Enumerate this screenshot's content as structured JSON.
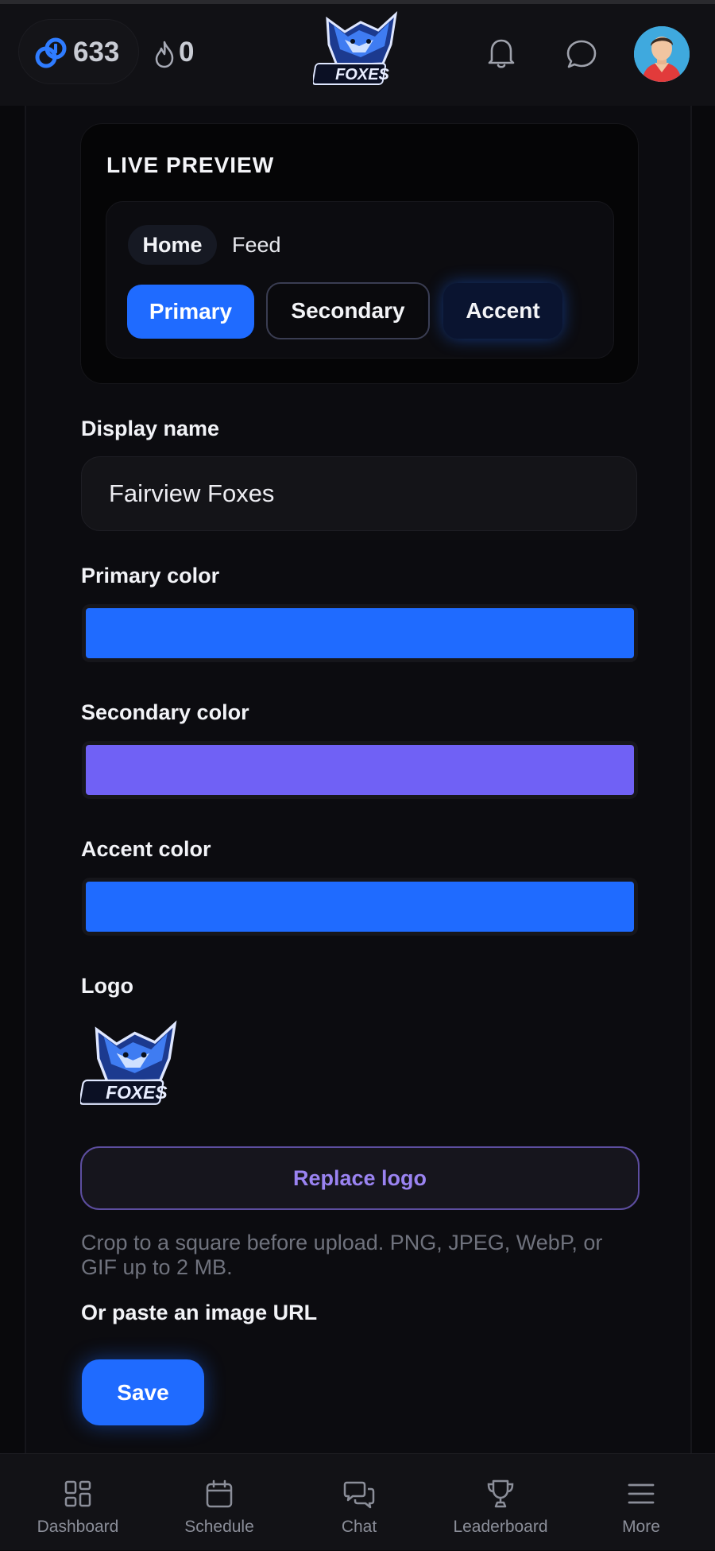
{
  "header": {
    "coins": "633",
    "streak": "0",
    "logo_text": "FOXES"
  },
  "preview": {
    "title": "LIVE PREVIEW",
    "tab_active": "Home",
    "tab_inactive": "Feed",
    "primary_label": "Primary",
    "secondary_label": "Secondary",
    "accent_label": "Accent"
  },
  "form": {
    "display_name_label": "Display name",
    "display_name_value": "Fairview Foxes",
    "primary_color_label": "Primary color",
    "primary_color": "#1f6bff",
    "secondary_color_label": "Secondary color",
    "secondary_color": "#7061f5",
    "accent_color_label": "Accent color",
    "accent_color": "#1f6bff",
    "logo_label": "Logo",
    "replace_logo_label": "Replace logo",
    "help_text": "Crop to a square before upload. PNG, JPEG, WebP, or GIF up to 2 MB.",
    "url_label": "Or paste an image URL",
    "save_label": "Save"
  },
  "nav": {
    "items": [
      {
        "label": "Dashboard",
        "icon": "dashboard-icon"
      },
      {
        "label": "Schedule",
        "icon": "calendar-icon"
      },
      {
        "label": "Chat",
        "icon": "chat-icon"
      },
      {
        "label": "Leaderboard",
        "icon": "trophy-icon"
      },
      {
        "label": "More",
        "icon": "menu-icon"
      }
    ]
  },
  "colors": {
    "brand_blue": "#1f6bff",
    "brand_purple": "#7061f5",
    "background": "#09090c"
  }
}
